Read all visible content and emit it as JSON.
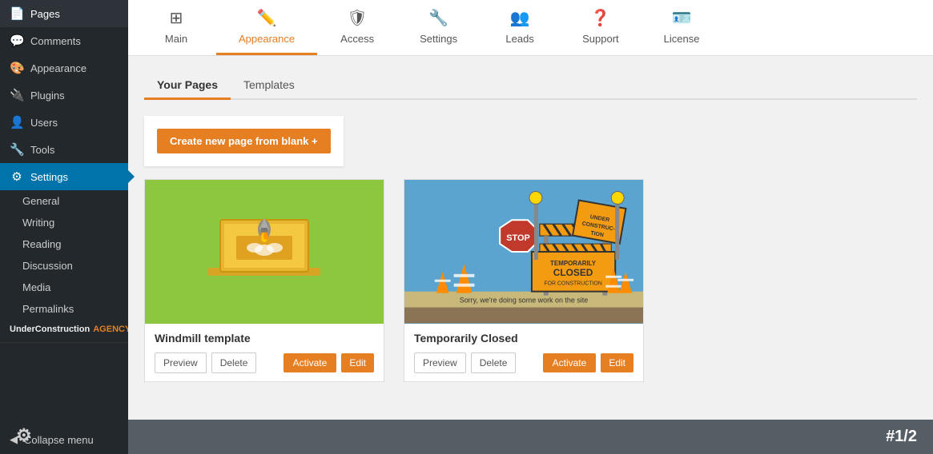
{
  "sidebar": {
    "items": [
      {
        "id": "pages",
        "label": "Pages",
        "icon": "📄"
      },
      {
        "id": "comments",
        "label": "Comments",
        "icon": "💬"
      },
      {
        "id": "appearance",
        "label": "Appearance",
        "icon": "🎨"
      },
      {
        "id": "plugins",
        "label": "Plugins",
        "icon": "🔌"
      },
      {
        "id": "users",
        "label": "Users",
        "icon": "👤"
      },
      {
        "id": "tools",
        "label": "Tools",
        "icon": "🔧"
      },
      {
        "id": "settings",
        "label": "Settings",
        "icon": "⚙",
        "active": true
      }
    ],
    "sub_items": [
      {
        "id": "general",
        "label": "General"
      },
      {
        "id": "writing",
        "label": "Writing"
      },
      {
        "id": "reading",
        "label": "Reading"
      },
      {
        "id": "discussion",
        "label": "Discussion"
      },
      {
        "id": "media",
        "label": "Media"
      },
      {
        "id": "permalinks",
        "label": "Permalinks"
      }
    ],
    "underconstruction": "UnderConstruction",
    "agency": "AGENCY",
    "collapse_label": "Collapse menu"
  },
  "plugin_tabs": [
    {
      "id": "main",
      "label": "Main",
      "icon": "⊞"
    },
    {
      "id": "appearance",
      "label": "Appearance",
      "icon": "✏️",
      "active": true
    },
    {
      "id": "access",
      "label": "Access",
      "icon": "🛡"
    },
    {
      "id": "settings",
      "label": "Settings",
      "icon": "🔧"
    },
    {
      "id": "leads",
      "label": "Leads",
      "icon": "👥"
    },
    {
      "id": "support",
      "label": "Support",
      "icon": "❓"
    },
    {
      "id": "license",
      "label": "License",
      "icon": "🪪"
    }
  ],
  "page_tabs": [
    {
      "id": "your-pages",
      "label": "Your Pages",
      "active": true
    },
    {
      "id": "templates",
      "label": "Templates"
    }
  ],
  "create_button": "Create new page from blank +",
  "templates": [
    {
      "id": "windmill",
      "name": "Windmill template",
      "actions": {
        "preview": "Preview",
        "delete": "Delete",
        "activate": "Activate",
        "edit": "Edit"
      }
    },
    {
      "id": "temporarily-closed",
      "name": "Temporarily Closed",
      "actions": {
        "preview": "Preview",
        "delete": "Delete",
        "activate": "Activate",
        "edit": "Edit"
      }
    }
  ],
  "footer": {
    "pagination": "#1/2",
    "gear_icon": "⚙"
  }
}
